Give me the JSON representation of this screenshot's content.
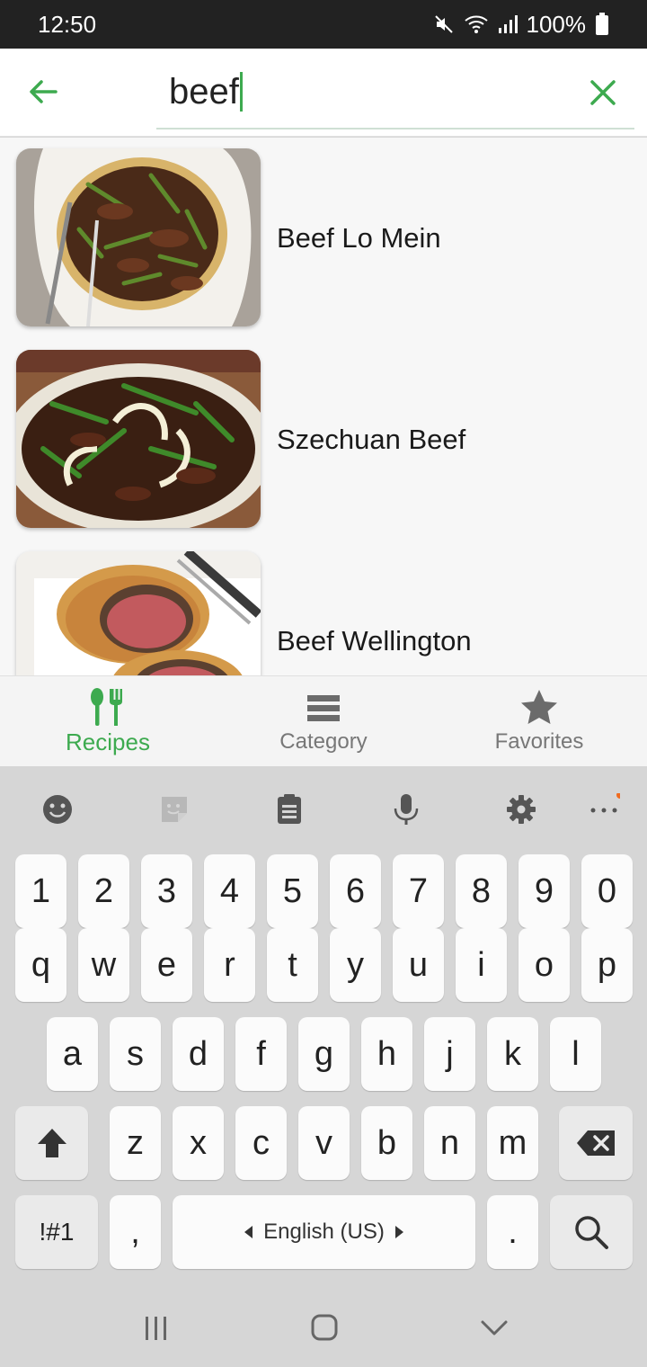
{
  "status_bar": {
    "time": "12:50",
    "battery": "100%"
  },
  "search": {
    "query": "beef"
  },
  "results": [
    {
      "title": "Beef Lo Mein"
    },
    {
      "title": "Szechuan Beef"
    },
    {
      "title": "Beef Wellington"
    }
  ],
  "bottom_nav": {
    "items": [
      {
        "label": "Recipes",
        "icon": "fork-knife-icon",
        "active": true
      },
      {
        "label": "Category",
        "icon": "list-icon",
        "active": false
      },
      {
        "label": "Favorites",
        "icon": "star-icon",
        "active": false
      }
    ]
  },
  "keyboard": {
    "toolbar": [
      "emoji-icon",
      "sticker-icon",
      "clipboard-icon",
      "microphone-icon",
      "settings-icon",
      "more-icon"
    ],
    "number_row": [
      "1",
      "2",
      "3",
      "4",
      "5",
      "6",
      "7",
      "8",
      "9",
      "0"
    ],
    "row1": [
      "q",
      "w",
      "e",
      "r",
      "t",
      "y",
      "u",
      "i",
      "o",
      "p"
    ],
    "row2": [
      "a",
      "s",
      "d",
      "f",
      "g",
      "h",
      "j",
      "k",
      "l"
    ],
    "row3": [
      "z",
      "x",
      "c",
      "v",
      "b",
      "n",
      "m"
    ],
    "symbols_label": "!#1",
    "comma": ",",
    "space_label": "English (US)",
    "period": "."
  },
  "colors": {
    "accent": "#3daa4f",
    "inactive": "#777777"
  }
}
